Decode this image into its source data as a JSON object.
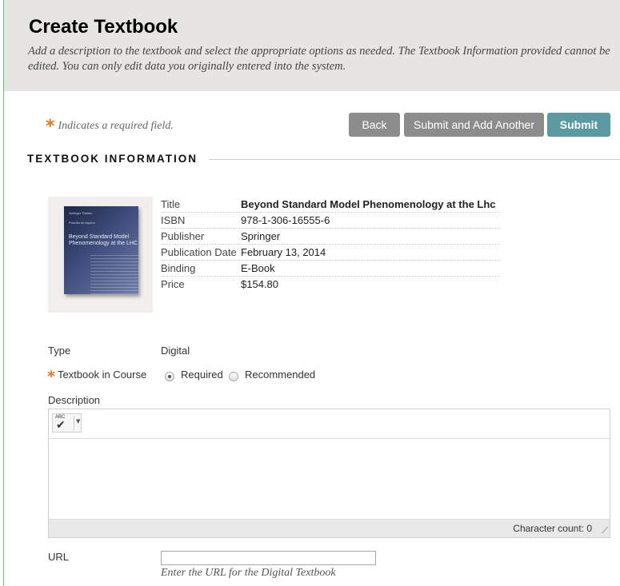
{
  "header": {
    "title": "Create Textbook",
    "description": "Add a description to the textbook and select the appropriate options as needed. The Textbook Information provided cannot be edited. You can only edit data you originally entered into the system."
  },
  "required_note": {
    "symbol": "*",
    "text": "Indicates a required field."
  },
  "buttons": {
    "back": "Back",
    "submit_and_add": "Submit and Add Another",
    "submit": "Submit"
  },
  "section_title": "TEXTBOOK INFORMATION",
  "cover": {
    "series": "Springer Theses",
    "subtitle": "Recognizing Outstanding Ph.D. Research",
    "author": "Priscilla de Aquino",
    "title": "Beyond Standard Model Phenomenology at the LHC"
  },
  "textbook": [
    {
      "label": "Title",
      "value": "Beyond Standard Model Phenomenology at the Lhc"
    },
    {
      "label": "ISBN",
      "value": "978-1-306-16555-6"
    },
    {
      "label": "Publisher",
      "value": "Springer"
    },
    {
      "label": "Publication Date",
      "value": "February 13, 2014"
    },
    {
      "label": "Binding",
      "value": "E-Book"
    },
    {
      "label": "Price",
      "value": "$154.80"
    }
  ],
  "type": {
    "label": "Type",
    "value": "Digital"
  },
  "textbook_in_course": {
    "symbol": "*",
    "label": "Textbook in Course",
    "options": [
      "Required",
      "Recommended"
    ],
    "selected": "Required"
  },
  "description": {
    "label": "Description",
    "spellcheck_icon_text": "ABC",
    "character_count": "Character count: 0"
  },
  "url": {
    "label": "URL",
    "value": "",
    "help": "Enter the URL for the Digital Textbook"
  }
}
